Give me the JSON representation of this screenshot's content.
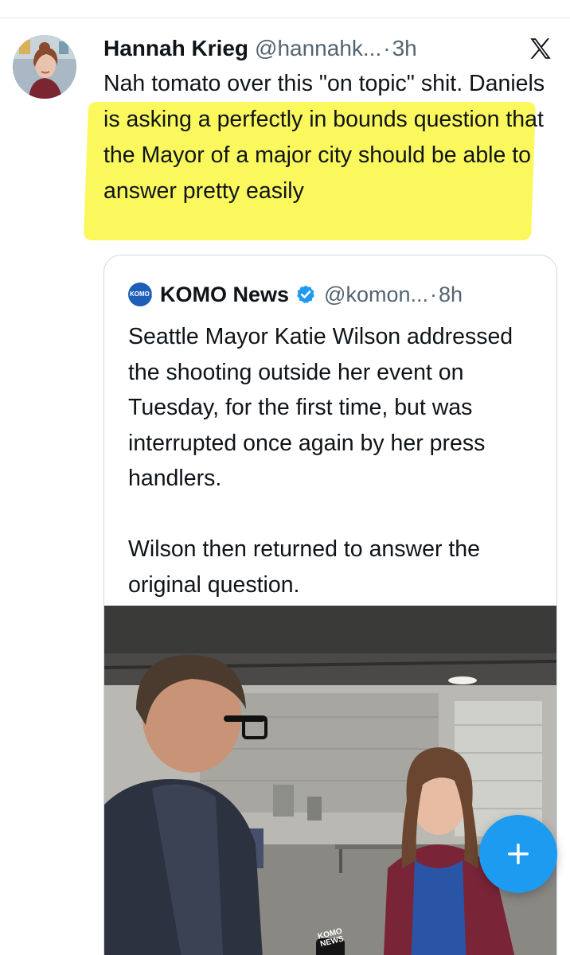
{
  "post": {
    "author_name": "Hannah Krieg",
    "handle": "@hannahk...",
    "separator": "·",
    "time": "3h",
    "text_part1": "Nah tomato over this \"on topic\" shit. ",
    "text_part2": "Daniels is asking a perfectly in bounds question that the Mayor of a major city should be able to answer pretty easily",
    "platform_icon": "x-logo-icon"
  },
  "quoted_post": {
    "logo_text": "KOMO NEWS",
    "author_name": "KOMO News",
    "verified": true,
    "handle": "@komon...",
    "separator": "·",
    "time": "8h",
    "paragraph1": "Seattle Mayor Katie Wilson addressed the shooting outside her event on Tuesday, for the first time, but was interrupted once again by her press handlers.",
    "paragraph2": "Wilson then returned to answer the original question.",
    "media_watermark": "KOMO NEWS"
  },
  "compose_button": {
    "icon": "plus-icon"
  },
  "colors": {
    "highlight": "#fbf750",
    "verified_blue": "#1d9bf0",
    "fab_blue": "#1d9bf0",
    "secondary_text": "#536471"
  }
}
